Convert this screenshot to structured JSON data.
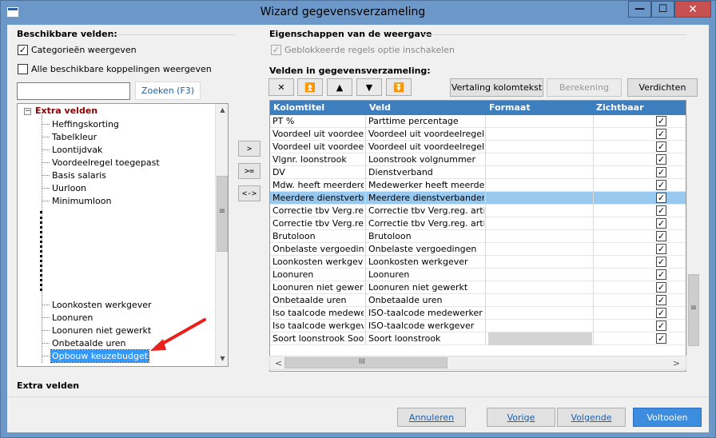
{
  "window": {
    "title": "Wizard gegevensverzameling",
    "close_icon": "✕",
    "maximize_icon": "☐",
    "minimize_icon": "—"
  },
  "left": {
    "heading": "Beschikbare velden:",
    "show_categories": {
      "label": "Categorieën weergeven",
      "checked": true
    },
    "show_links": {
      "label": "Alle beschikbare koppelingen weergeven",
      "checked": false
    },
    "search": {
      "value": "",
      "button": "Zoeken (F3)"
    },
    "tree": {
      "root": "Extra velden",
      "root_expander": "−",
      "items_top": [
        "Heffingskorting",
        "Tabelkleur",
        "Loontijdvak",
        "Voordeelregel toegepast",
        "Basis salaris",
        "Uurloon",
        "Minimumloon"
      ],
      "items_bottom": [
        "Loonkosten werkgever",
        "Loonuren",
        "Loonuren niet gewerkt",
        "Onbetaalde uren",
        "Opbouw keuzebudget"
      ],
      "selected": "Opbouw keuzebudget",
      "scroll_up": "▲",
      "scroll_down": "▼",
      "thumb_grip": "≡"
    },
    "footer_label": "Extra velden"
  },
  "middle": {
    "add": ">",
    "add_all": ">=",
    "swap": "<->"
  },
  "right": {
    "heading": "Eigenschappen van de weergave",
    "blocked_rules": {
      "label": "Geblokkeerde regels optie inschakelen",
      "checked": true
    },
    "fields_heading": "Velden in gegevensverzameling:",
    "nav": {
      "remove": "✕",
      "top": "⏫",
      "up": "▲",
      "down": "▼",
      "bottom": "⏬"
    },
    "translate_button": "Vertaling kolomtekst",
    "calc_button": "Berekening",
    "compress_button": "Verdichten",
    "columns": [
      "Kolomtitel",
      "Veld",
      "Formaat",
      "Zichtbaar"
    ],
    "rows": [
      {
        "title": "PT %",
        "field": "Parttime percentage",
        "visible": true
      },
      {
        "title": "Voordeel uit voordeelregel",
        "field": "Voordeel uit voordeelregel",
        "visible": true
      },
      {
        "title": "Voordeel uit voordeelregel",
        "field": "Voordeel uit voordeelregel (Cum",
        "visible": true
      },
      {
        "title": "Vlgnr. loonstrook",
        "field": "Loonstrook volgnummer",
        "visible": true
      },
      {
        "title": "DV",
        "field": "Dienstverband",
        "visible": true
      },
      {
        "title": "Mdw. heeft meerdere DV",
        "field": "Medewerker heeft meerdere di",
        "visible": true
      },
      {
        "title": "Meerdere dienstverbanden",
        "field": "Meerdere dienstverbanden ge",
        "visible": true
      },
      {
        "title": "Correctie tbv Verg.reg. A",
        "field": "Correctie tbv Verg.reg. artieste",
        "visible": true
      },
      {
        "title": "Correctie tbv Verg.reg. A",
        "field": "Correctie tbv Verg.reg. artieste",
        "visible": true
      },
      {
        "title": "Brutoloon",
        "field": "Brutoloon",
        "visible": true
      },
      {
        "title": "Onbelaste vergoedingen",
        "field": "Onbelaste vergoedingen",
        "visible": true
      },
      {
        "title": "Loonkosten werkgever",
        "field": "Loonkosten werkgever",
        "visible": true
      },
      {
        "title": "Loonuren",
        "field": "Loonuren",
        "visible": true
      },
      {
        "title": "Loonuren niet gewerkt",
        "field": "Loonuren niet gewerkt",
        "visible": true
      },
      {
        "title": "Onbetaalde uren",
        "field": "Onbetaalde uren",
        "visible": true
      },
      {
        "title": "Iso taalcode medewerker",
        "field": "ISO-taalcode medewerker",
        "visible": true
      },
      {
        "title": "Iso taalcode werkgever",
        "field": "ISO-taalcode werkgever",
        "visible": true
      },
      {
        "title": "Soort loonstrook Soort lo",
        "field": "Soort loonstrook",
        "visible": true
      }
    ],
    "selected_row": 6,
    "check_mark": "✓",
    "hscroll_left": "<",
    "hscroll_right": ">",
    "hscroll_grip": "III"
  },
  "footer": {
    "cancel": "Annuleren",
    "back": "Vorige",
    "next": "Volgende",
    "finish": "Voltooien"
  }
}
